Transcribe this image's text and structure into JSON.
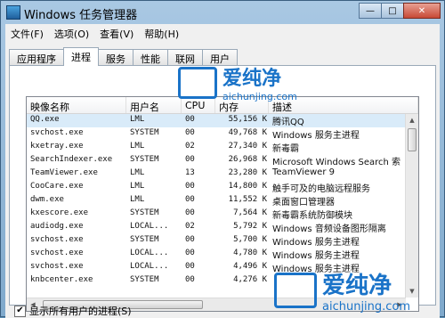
{
  "window": {
    "title": "Windows 任务管理器",
    "min_label": "—",
    "max_label": "□",
    "close_label": "✕"
  },
  "menu": [
    "文件(F)",
    "选项(O)",
    "查看(V)",
    "帮助(H)"
  ],
  "tabs": [
    "应用程序",
    "进程",
    "服务",
    "性能",
    "联网",
    "用户"
  ],
  "active_tab": "进程",
  "columns": {
    "name": "映像名称",
    "user": "用户名",
    "cpu": "CPU",
    "mem": "内存",
    "desc": "描述"
  },
  "processes": [
    {
      "name": "QQ.exe",
      "user": "LML",
      "cpu": "00",
      "mem": "55,156 K",
      "desc": "腾讯QQ"
    },
    {
      "name": "svchost.exe",
      "user": "SYSTEM",
      "cpu": "00",
      "mem": "49,768 K",
      "desc": "Windows 服务主进程"
    },
    {
      "name": "kxetray.exe",
      "user": "LML",
      "cpu": "02",
      "mem": "27,340 K",
      "desc": "新毒霸"
    },
    {
      "name": "SearchIndexer.exe",
      "user": "SYSTEM",
      "cpu": "00",
      "mem": "26,968 K",
      "desc": "Microsoft Windows Search 索"
    },
    {
      "name": "TeamViewer.exe",
      "user": "LML",
      "cpu": "13",
      "mem": "23,280 K",
      "desc": "TeamViewer 9"
    },
    {
      "name": "CooCare.exe",
      "user": "LML",
      "cpu": "00",
      "mem": "14,800 K",
      "desc": "触手可及的电脑远程服务"
    },
    {
      "name": "dwm.exe",
      "user": "LML",
      "cpu": "00",
      "mem": "11,552 K",
      "desc": "桌面窗口管理器"
    },
    {
      "name": "kxescore.exe",
      "user": "SYSTEM",
      "cpu": "00",
      "mem": "7,564 K",
      "desc": "新毒霸系统防御模块"
    },
    {
      "name": "audiodg.exe",
      "user": "LOCAL...",
      "cpu": "02",
      "mem": "5,792 K",
      "desc": "Windows 音频设备图形隔离"
    },
    {
      "name": "svchost.exe",
      "user": "SYSTEM",
      "cpu": "00",
      "mem": "5,700 K",
      "desc": "Windows 服务主进程"
    },
    {
      "name": "svchost.exe",
      "user": "LOCAL...",
      "cpu": "00",
      "mem": "4,780 K",
      "desc": "Windows 服务主进程"
    },
    {
      "name": "svchost.exe",
      "user": "LOCAL...",
      "cpu": "00",
      "mem": "4,496 K",
      "desc": "Windows 服务主进程"
    },
    {
      "name": "knbcenter.exe",
      "user": "SYSTEM",
      "cpu": "00",
      "mem": "4,276 K",
      "desc": ""
    }
  ],
  "show_all_users_label": "显示所有用户的进程(S)",
  "show_all_users_checked": true,
  "watermark": {
    "brand": "爱纯净",
    "url": "aichunjing.com"
  }
}
